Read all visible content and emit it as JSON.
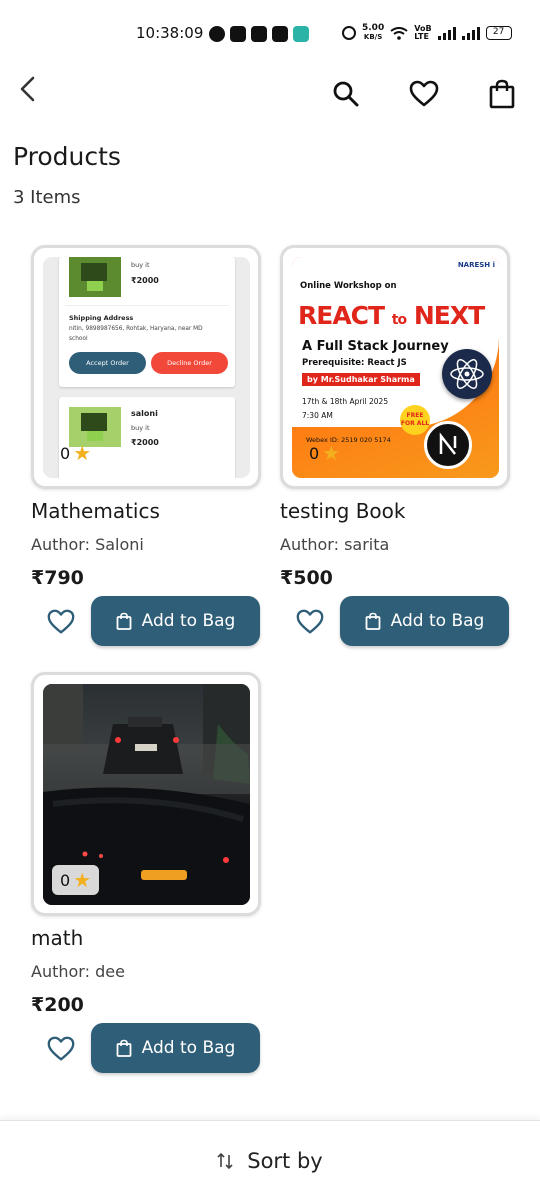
{
  "status_bar": {
    "time": "10:38:09",
    "net_speed_value": "5.00",
    "net_speed_unit": "KB/S",
    "volte_top": "VoB",
    "volte_bottom": "LTE",
    "battery": "27",
    "notification_icons": [
      "snapchat-icon",
      "instagram-icon",
      "youtube-icon",
      "linkedin-icon",
      "chat-app-icon"
    ]
  },
  "header": {
    "back_icon": "chevron-left-icon",
    "search_icon": "search-icon",
    "wishlist_icon": "heart-icon",
    "bag_icon": "shopping-bag-icon"
  },
  "page": {
    "title": "Products",
    "count": "3 Items"
  },
  "products": [
    {
      "name": "Mathematics",
      "author": "Author: Saloni",
      "price": "₹790",
      "rating": "0",
      "add_label": "Add to Bag",
      "thumb": {
        "buy_it": "buy it",
        "price1": "₹2000",
        "shipping_title": "Shipping Address",
        "shipping_line1": "nitin, 9898987656, Rohtak, Haryana, near MD",
        "shipping_line2": "school",
        "accept": "Accept Order",
        "decline": "Decline Order",
        "user2": "saloni",
        "buy_it2": "buy it",
        "price2": "₹2000"
      }
    },
    {
      "name": "testing Book",
      "author": "Author: sarita",
      "price": "₹500",
      "rating": "0",
      "add_label": "Add to Bag",
      "thumb": {
        "brand": "NARESH i",
        "online": "Online Workshop on",
        "react": "REACT",
        "to": "to",
        "next": "NEXT",
        "subtitle": "A Full Stack Journey",
        "prereq": "Prerequisite: React JS",
        "by": "by Mr.Sudhakar Sharma",
        "date": "17th & 18th April 2025",
        "time": "7:30 AM",
        "free": "FREE FOR ALL",
        "webex": "Webex ID: 2519 020 5174"
      }
    },
    {
      "name": "math",
      "author": "Author: dee",
      "price": "₹200",
      "rating": "0",
      "add_label": "Add to Bag"
    }
  ],
  "sort": {
    "label": "Sort by"
  },
  "colors": {
    "accent": "#2f5e78",
    "star": "#f2b01e",
    "accept": "#2f5e78",
    "decline": "#f2483a"
  }
}
